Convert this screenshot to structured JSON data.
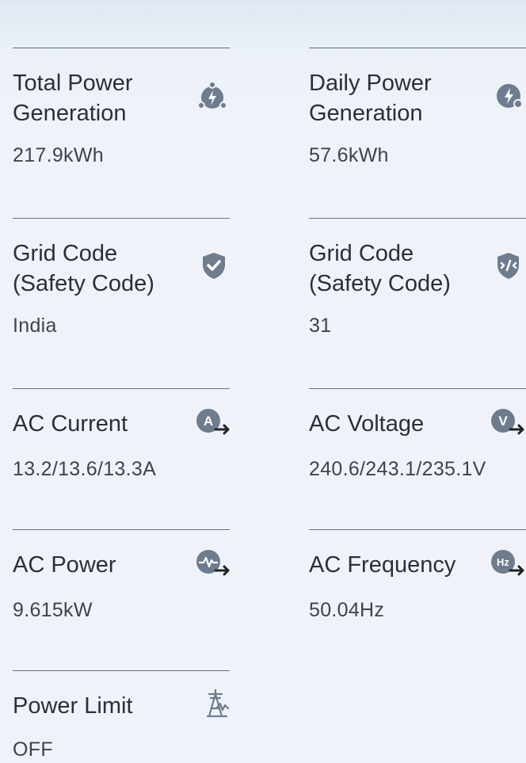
{
  "params": {
    "total_power": {
      "title": "Total Power Generation",
      "value": "217.9kWh",
      "icon": "power-generation-icon"
    },
    "daily_power": {
      "title": "Daily Power Generation",
      "value": "57.6kWh",
      "icon": "daily-power-icon"
    },
    "grid_code_1": {
      "title": "Grid Code (Safety Code)",
      "value": "India",
      "icon": "shield-check-icon"
    },
    "grid_code_2": {
      "title": "Grid Code (Safety Code)",
      "value": "31",
      "icon": "shield-code-icon"
    },
    "ac_current": {
      "title": "AC Current",
      "value": "13.2/13.6/13.3A",
      "icon": "ac-current-icon",
      "glyph": "A"
    },
    "ac_voltage": {
      "title": "AC Voltage",
      "value": "240.6/243.1/235.1V",
      "icon": "ac-voltage-icon",
      "glyph": "V"
    },
    "ac_power": {
      "title": "AC Power",
      "value": "9.615kW",
      "icon": "ac-power-icon"
    },
    "ac_frequency": {
      "title": "AC Frequency",
      "value": "50.04Hz",
      "icon": "ac-frequency-icon",
      "glyph": "Hz"
    },
    "power_limit": {
      "title": "Power Limit",
      "value": "OFF",
      "icon": "power-limit-icon"
    }
  },
  "colors": {
    "icon": "#6f7c8e",
    "text": "#2b2f36",
    "value": "#3c4350",
    "divider": "#6b6f75"
  }
}
